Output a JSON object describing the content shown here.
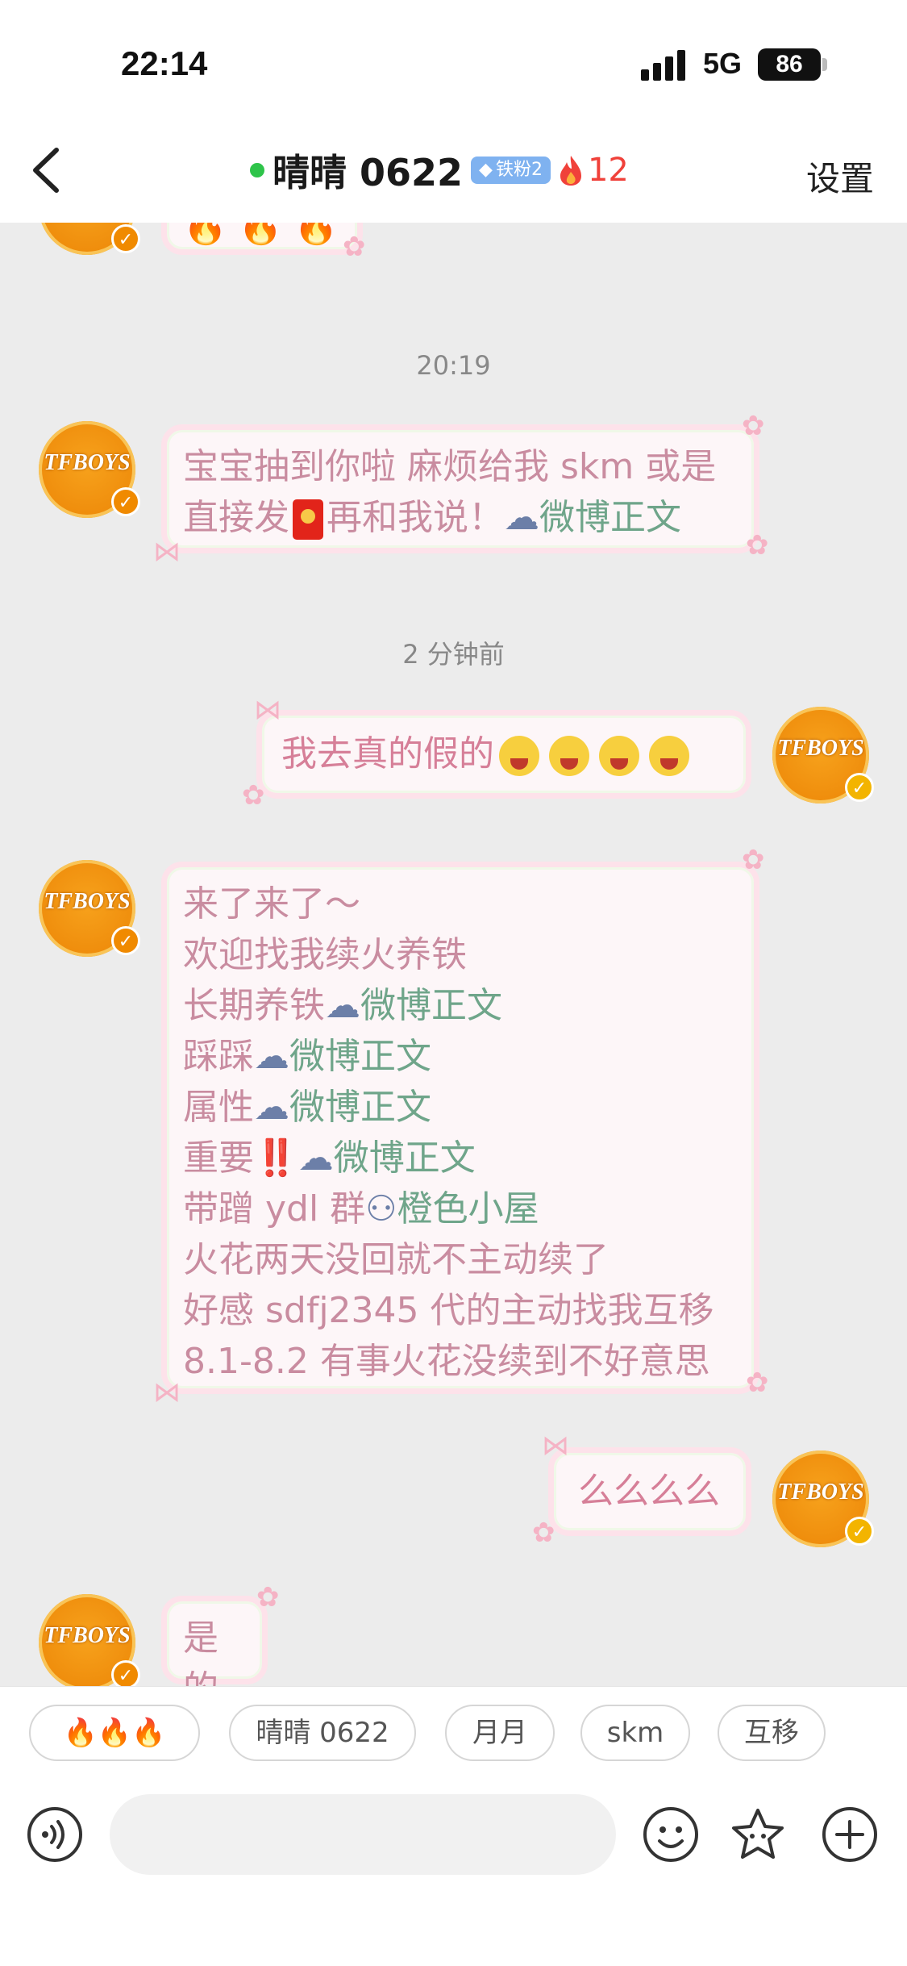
{
  "status_bar": {
    "time": "22:14",
    "network": "5G",
    "battery": "86"
  },
  "header": {
    "title": "晴晴 0622",
    "badge": "铁粉2",
    "fire_count": "12",
    "settings": "设置"
  },
  "timestamps": {
    "t1": "20:19",
    "t2": "2 分钟前"
  },
  "messages": {
    "m0_fire": "🔥 🔥 🔥",
    "m1_line1": "宝宝抽到你啦 麻烦给我 skm 或是",
    "m1_line2_a": "直接发",
    "m1_line2_b": "再和我说！",
    "m1_tag": "微博正文",
    "m2_text": "我去真的假的",
    "m3_lines": {
      "l1": "来了来了～",
      "l2": "欢迎找我续火养铁",
      "l3": "长期养铁",
      "l4": "踩踩",
      "l5": "属性",
      "l6": "重要",
      "l6_bang": "‼️",
      "l7": "带蹭 ydl 群",
      "l7_tag": "橙色小屋",
      "l8": "火花两天没回就不主动续了",
      "l9": "好感 sdfj2345 代的主动找我互移",
      "l10": "8.1-8.2 有事火花没续到不好意思",
      "tag": "微博正文"
    },
    "m4_text": "么么么么",
    "m5_text": "是的"
  },
  "quick_replies": [
    "🔥🔥🔥",
    "晴晴 0622",
    "月月",
    "skm",
    "互移"
  ],
  "avatar_logo": "TFBOYS",
  "icons": [
    "back-chevron-icon",
    "voice-icon",
    "emoji-icon",
    "sticker-icon",
    "plus-icon",
    "cloud-icon",
    "fire-icon",
    "diamond-icon",
    "verified-icon"
  ],
  "colors": {
    "online": "#2ec44a",
    "fire_count": "#f0413a",
    "badge": "#7fb2f0",
    "bubble_text": "#c98ca0",
    "tag": "#6fa58a"
  }
}
